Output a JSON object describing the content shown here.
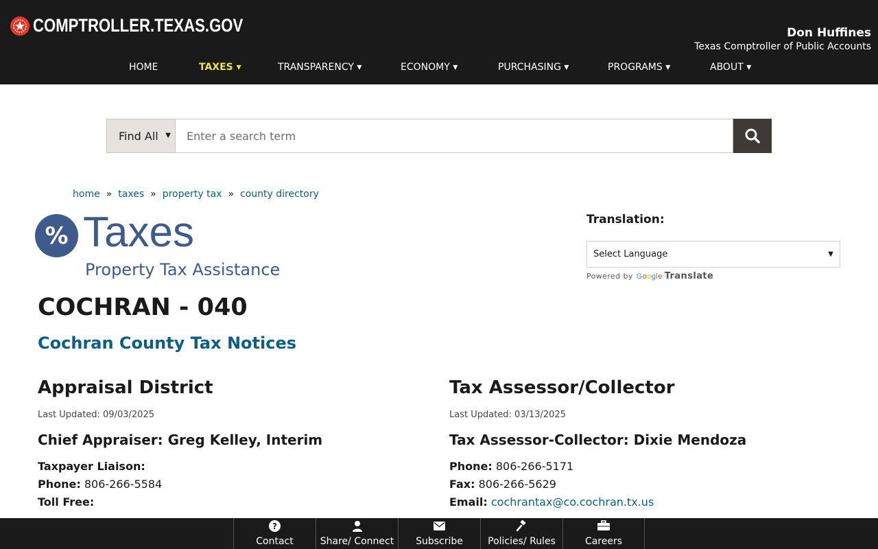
{
  "header": {
    "logo_text": "COMPTROLLER.TEXAS.GOV",
    "official_name": "Don Huffines",
    "official_title": "Texas Comptroller of Public Accounts",
    "nav": [
      {
        "label": "HOME"
      },
      {
        "label": "TAXES ▾",
        "active": true
      },
      {
        "label": "TRANSPARENCY ▾"
      },
      {
        "label": "ECONOMY ▾"
      },
      {
        "label": "PURCHASING ▾"
      },
      {
        "label": "PROGRAMS ▾"
      },
      {
        "label": "ABOUT ▾"
      }
    ],
    "accent_color": "#e9e34e"
  },
  "search": {
    "scope_label": "Find All",
    "placeholder": "Enter a search term"
  },
  "breadcrumb": [
    "home",
    "taxes",
    "property tax",
    "county directory"
  ],
  "section": {
    "badge": "%",
    "title": "Taxes",
    "subtitle": "Property Tax Assistance"
  },
  "translation": {
    "label": "Translation:",
    "select_value": "Select Language",
    "powered_by": "Powered by",
    "google": "Google",
    "translate": "Translate"
  },
  "county": {
    "title": "COCHRAN - 040",
    "notices_link": "Cochran County Tax Notices"
  },
  "appraisal": {
    "heading": "Appraisal District",
    "updated": "Last Updated: 09/03/2025",
    "chief": "Chief Appraiser: Greg Kelley, Interim",
    "liaison_label": "Taxpayer Liaison:",
    "phone_label": "Phone:",
    "phone": "806-266-5584",
    "tollfree_label": "Toll Free:"
  },
  "collector": {
    "heading": "Tax Assessor/Collector",
    "updated": "Last Updated: 03/13/2025",
    "name": "Tax Assessor-Collector: Dixie Mendoza",
    "phone_label": "Phone:",
    "phone": "806-266-5171",
    "fax_label": "Fax:",
    "fax": "806-266-5629",
    "email_label": "Email:",
    "email": "cochrantax@co.cochran.tx.us"
  },
  "footer": {
    "links": [
      {
        "label": "Contact",
        "icon": "question-circle-icon"
      },
      {
        "label": "Share/ Connect",
        "icon": "person-icon"
      },
      {
        "label": "Subscribe",
        "icon": "envelope-icon"
      },
      {
        "label": "Policies/ Rules",
        "icon": "gavel-icon"
      },
      {
        "label": "Careers",
        "icon": "briefcase-icon"
      }
    ]
  },
  "colors": {
    "link": "#0b5f86",
    "brand_blue": "#3e5b8c",
    "header_bg": "#1a1a1a",
    "star_red": "#e8352b"
  }
}
